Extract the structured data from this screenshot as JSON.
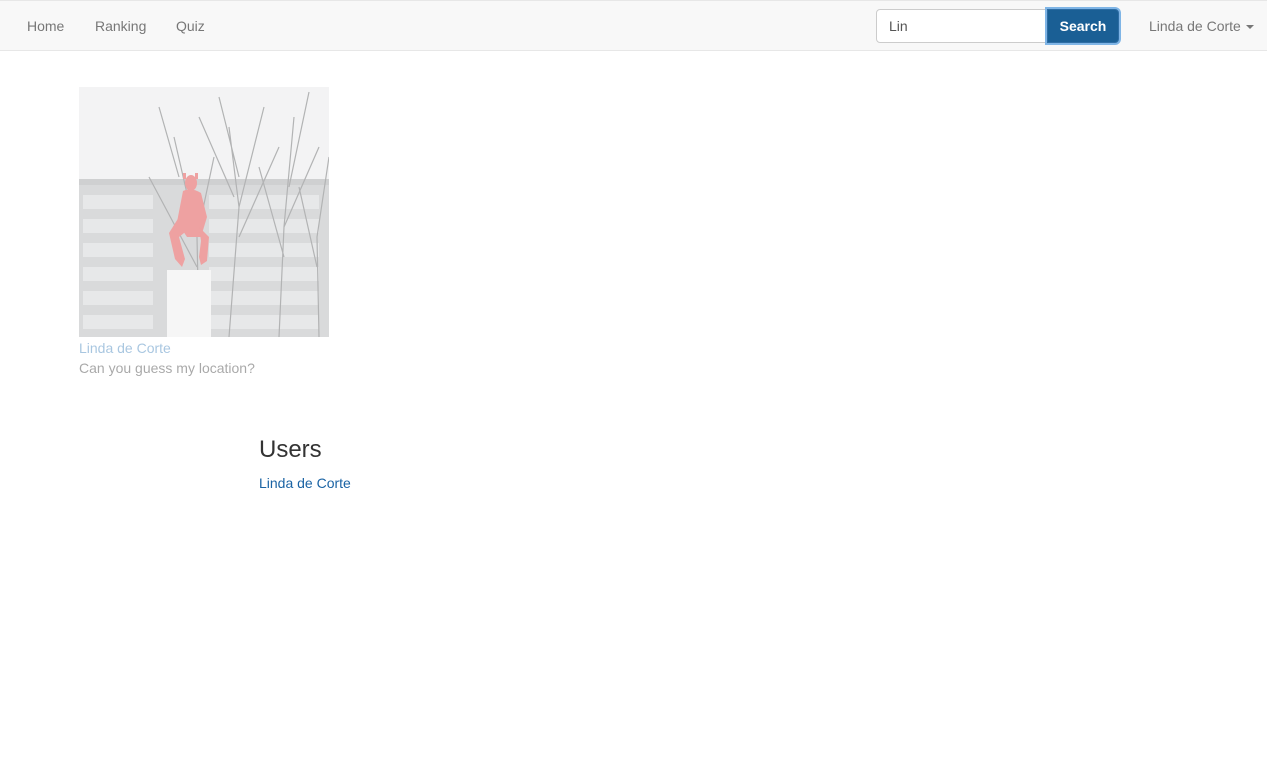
{
  "nav": {
    "links": [
      "Home",
      "Ranking",
      "Quiz"
    ],
    "search_value": "Lin",
    "search_button": "Search",
    "user_menu": "Linda de Corte"
  },
  "quiz": {
    "author": "Linda de Corte",
    "caption": "Can you guess my location?",
    "image_icon": "photo-red-statue-trees-building"
  },
  "users": {
    "heading": "Users",
    "results": [
      "Linda de Corte"
    ]
  },
  "colors": {
    "link": "#337ab7",
    "search_button": "#1a5f95",
    "navbar_bg": "#f8f8f8"
  }
}
